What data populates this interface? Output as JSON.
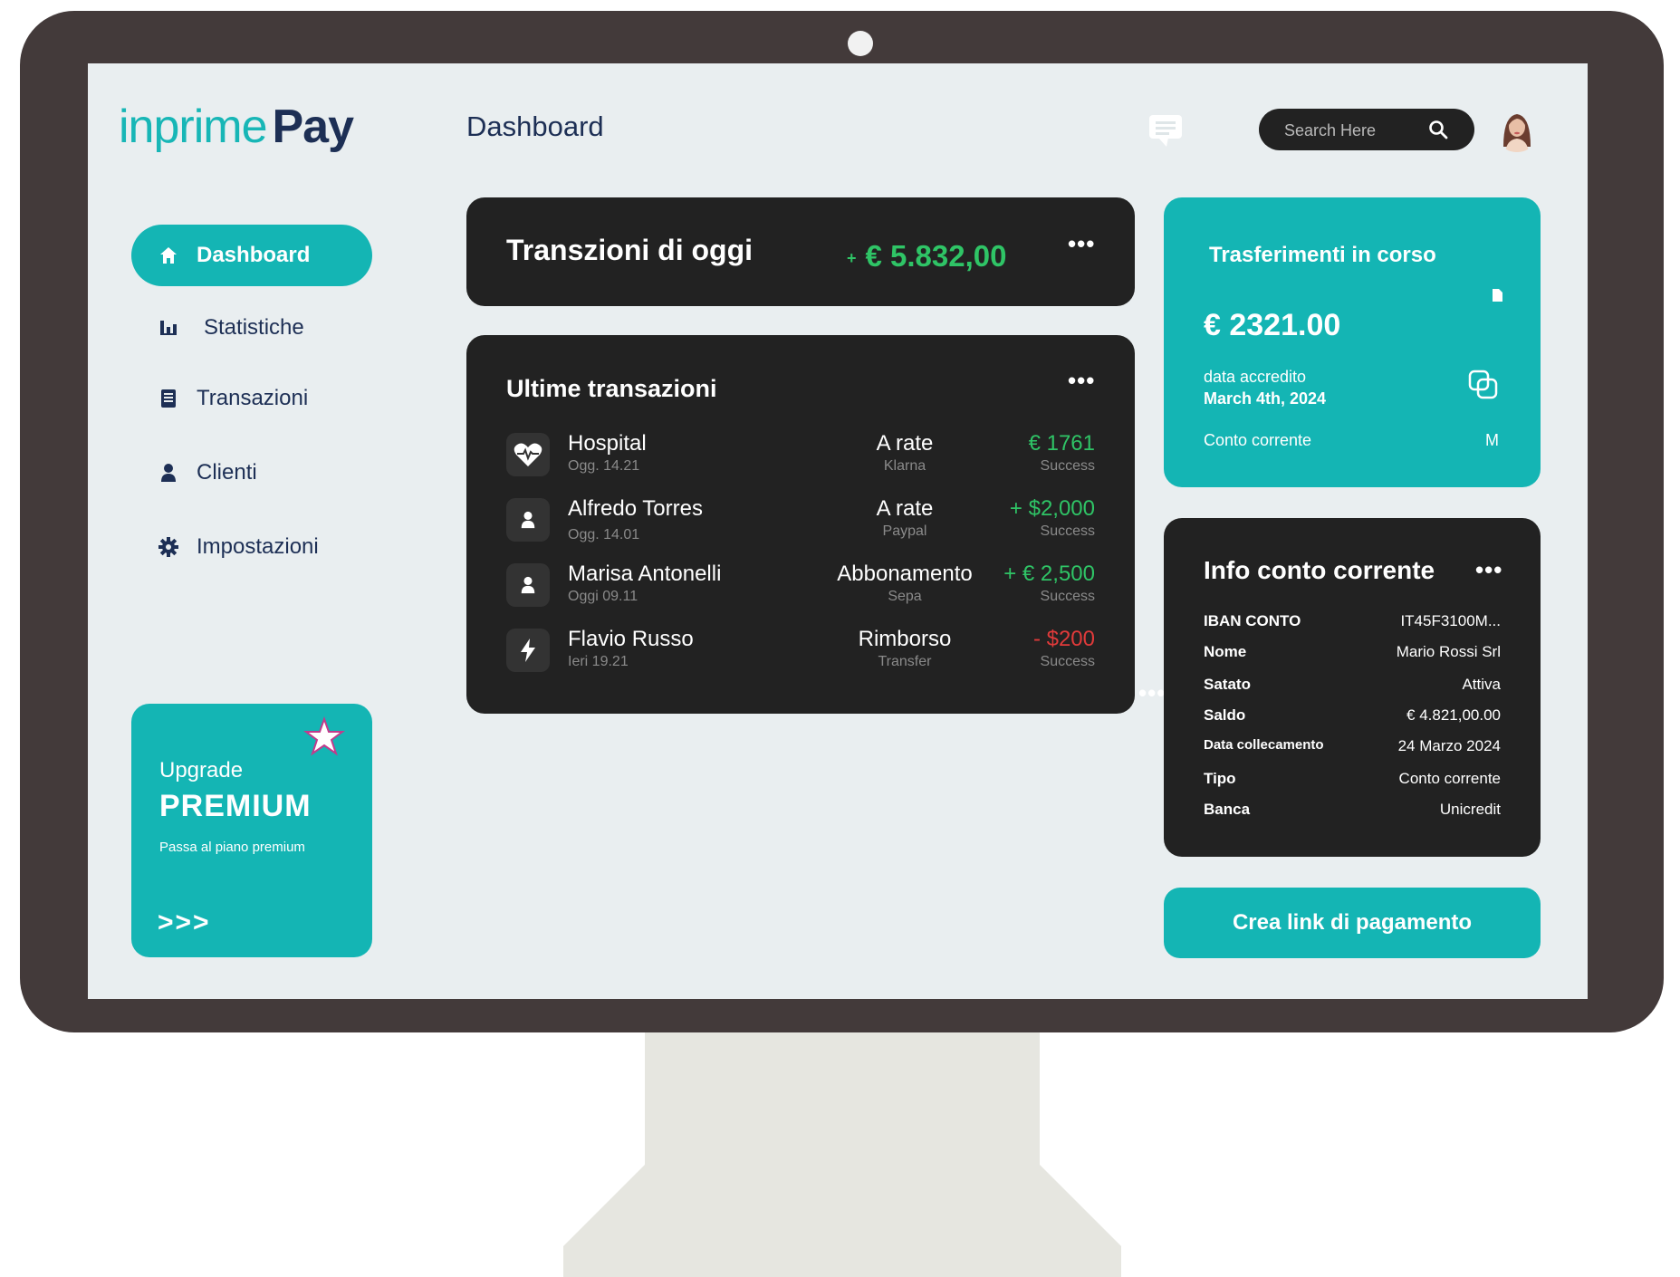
{
  "brand": {
    "name_part1": "inprime",
    "name_part2": "Pay"
  },
  "header": {
    "title": "Dashboard",
    "search": {
      "placeholder": "Search Here"
    }
  },
  "sidebar": {
    "items": [
      {
        "label": "Dashboard",
        "icon": "home-icon",
        "active": true
      },
      {
        "label": "Statistiche",
        "icon": "bar-chart-icon"
      },
      {
        "label": "Transazioni",
        "icon": "receipt-icon"
      },
      {
        "label": "Clienti",
        "icon": "user-icon"
      },
      {
        "label": "Impostazioni",
        "icon": "gear-icon"
      }
    ],
    "premium": {
      "upgrade": "Upgrade",
      "title": "PREMIUM",
      "subtitle": "Passa al piano premium",
      "arrows": ">>>"
    }
  },
  "today": {
    "title": "Transzioni di oggi",
    "plus": "+",
    "amount": "€ 5.832,00"
  },
  "transactions": {
    "title": "Ultime  transazioni",
    "rows": [
      {
        "name": "Hospital",
        "time": "Ogg. 14.21",
        "method": "A rate",
        "provider": "Klarna",
        "amount": "€ 1761",
        "status": "Success",
        "icon": "heart-icon",
        "color": "#2fc466"
      },
      {
        "name": "Alfredo Torres",
        "time": "Ogg. 14.01",
        "method": "A rate",
        "provider": "Paypal",
        "amount": "+ $2,000",
        "status": "Success",
        "icon": "user-icon",
        "color": "#2fc466"
      },
      {
        "name": "Marisa Antonelli",
        "time": "Oggi 09.11",
        "method": "Abbonamento",
        "provider": "Sepa",
        "amount": "+ € 2,500",
        "status": "Success",
        "icon": "user-icon",
        "color": "#2fc466"
      },
      {
        "name": "Flavio Russo",
        "time": "Ieri 19.21",
        "method": "Rimborso",
        "provider": "Transfer",
        "amount": "- $200",
        "status": "Success",
        "icon": "lightning-icon",
        "color": "#e03a3a"
      }
    ]
  },
  "transfer": {
    "title": "Trasferimenti in corso",
    "amount": "€ 2321.00",
    "date_label": "data accredito",
    "date": "March 4th, 2024",
    "account": "Conto corrente",
    "account_code": "M"
  },
  "account_info": {
    "title": "Info conto corrente",
    "rows": [
      {
        "key": "IBAN CONTO",
        "value": "IT45F3100M..."
      },
      {
        "key": "Nome",
        "value": "Mario Rossi Srl"
      },
      {
        "key": "Satato",
        "value": "Attiva"
      },
      {
        "key": "Saldo",
        "value": "€ 4.821,00.00"
      },
      {
        "key": "Data collecamento",
        "value": "24 Marzo 2024"
      },
      {
        "key": "Tipo",
        "value": "Conto corrente"
      },
      {
        "key": "Banca",
        "value": "Unicredit"
      }
    ]
  },
  "cta": {
    "label": "Crea link di pagamento"
  },
  "colors": {
    "accent": "#14b5b4",
    "navy": "#1d2f55",
    "dark_card": "#222222",
    "positive": "#2fc466",
    "negative": "#e03a3a"
  }
}
